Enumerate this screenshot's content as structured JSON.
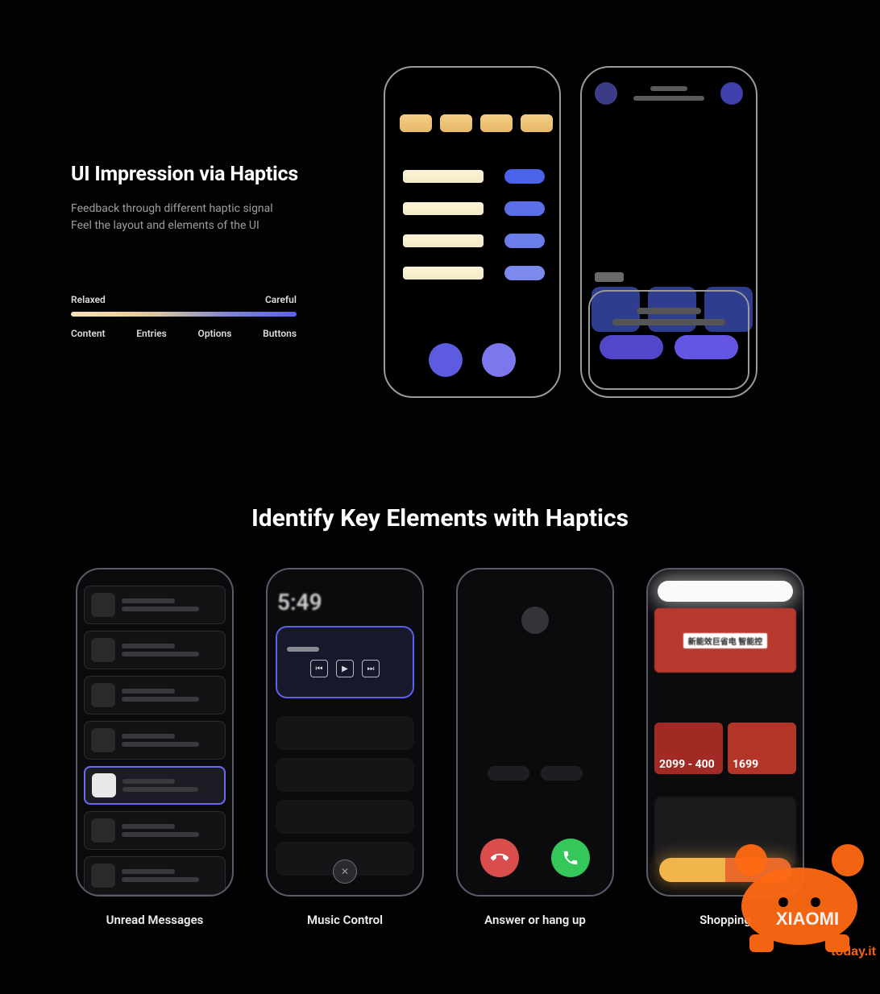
{
  "section1": {
    "title": "UI Impression via Haptics",
    "desc_line1": "Feedback through different haptic signal",
    "desc_line2": "Feel the layout and elements of the UI"
  },
  "legend": {
    "left": "Relaxed",
    "right": "Careful",
    "items": [
      "Content",
      "Entries",
      "Options",
      "Buttons"
    ]
  },
  "section2": {
    "title": "Identify Key Elements with Haptics"
  },
  "examples": {
    "unread_messages": {
      "label": "Unread Messages"
    },
    "music_control": {
      "label": "Music Control",
      "time": "5:49",
      "prev": "⏮",
      "play": "▶",
      "next": "⏭",
      "close": "✕"
    },
    "answer_hangup": {
      "label": "Answer or hang up"
    },
    "shopping": {
      "label": "Shopping",
      "banner_text": "新能效巨省电 智能控",
      "tile1_price": "2099 - 400",
      "tile2_price": "1699"
    }
  },
  "watermark": {
    "brand": "XIAOMI",
    "site": "today.it"
  }
}
